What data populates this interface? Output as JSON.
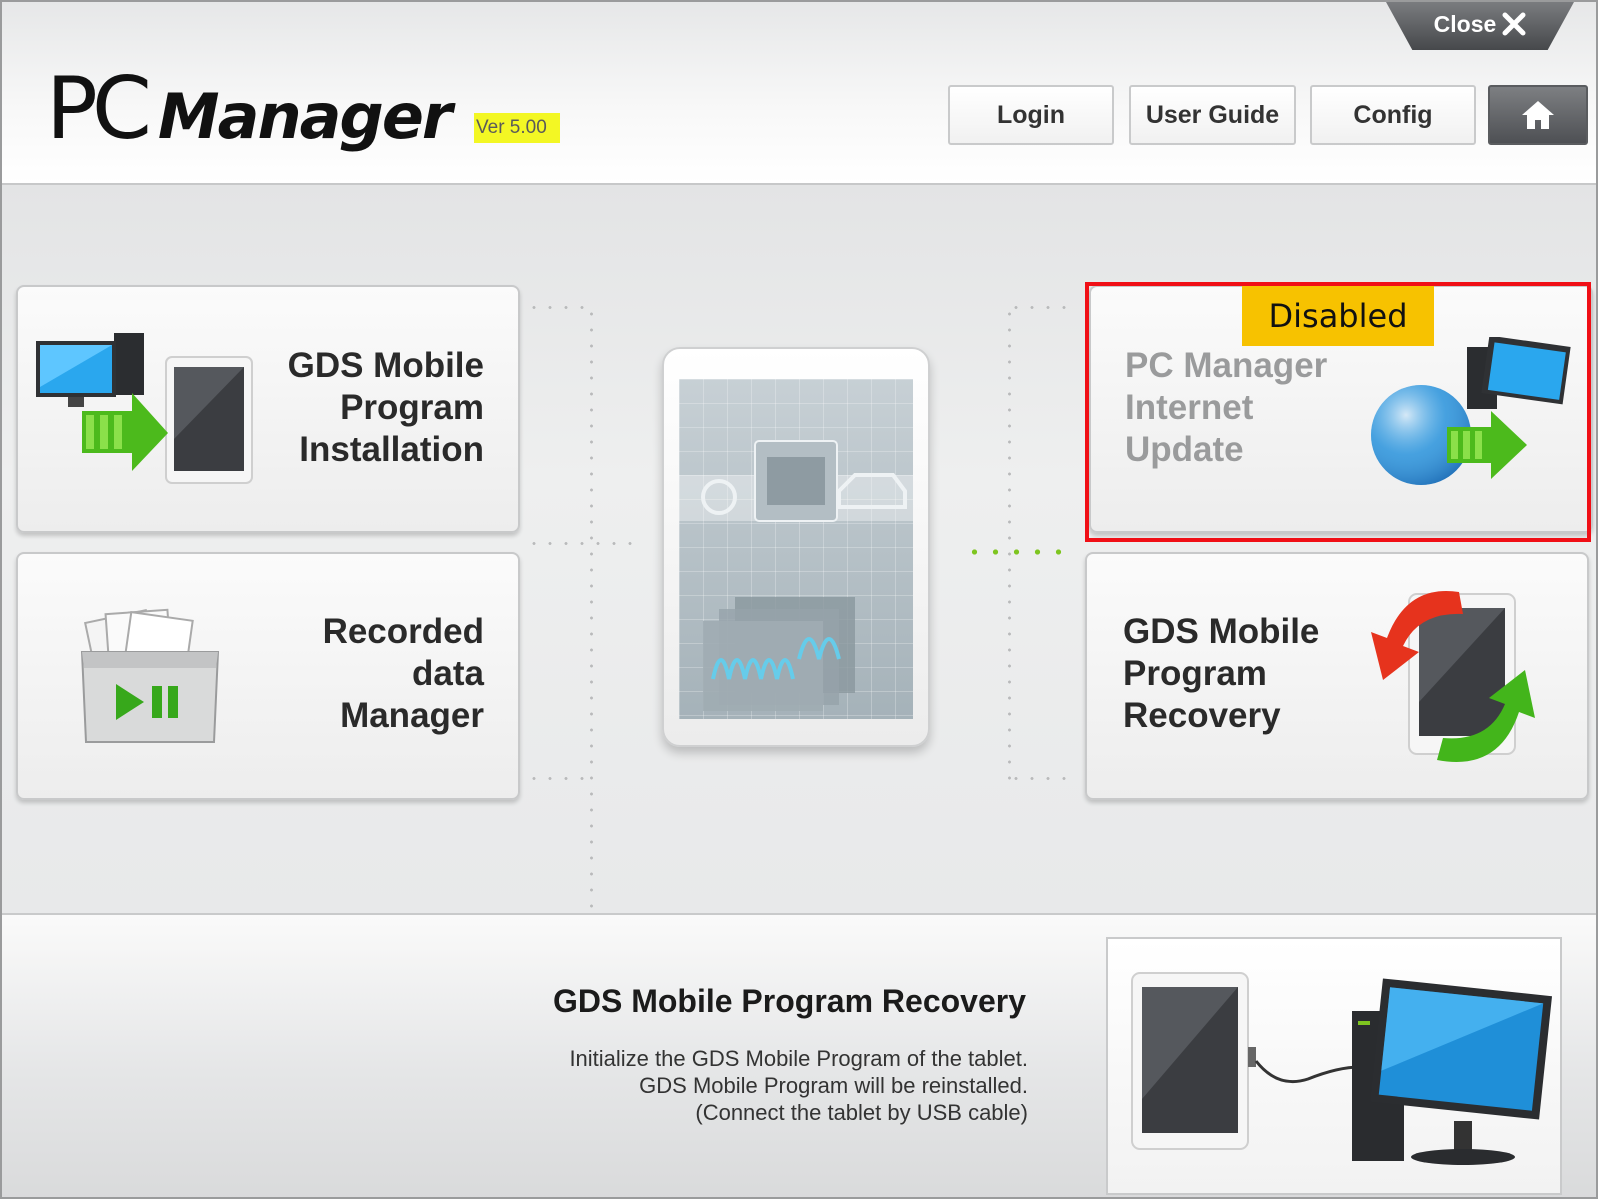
{
  "header": {
    "logo_pc": "PC",
    "logo_manager": "Manager",
    "version": "Ver 5.00",
    "close_label": "Close",
    "close_icon": "close-x-icon",
    "buttons": {
      "login": "Login",
      "user_guide": "User Guide",
      "config": "Config",
      "home_icon": "home-icon"
    }
  },
  "cards": {
    "install": {
      "line1": "GDS Mobile",
      "line2": "Program",
      "line3": "Installation",
      "icon": "pc-to-tablet-icon"
    },
    "recorded": {
      "line1": "Recorded",
      "line2": "data",
      "line3": "Manager",
      "icon": "folder-play-pause-icon"
    },
    "update": {
      "line1": "PC Manager",
      "line2": "Internet",
      "line3": "Update",
      "icon": "globe-to-pc-icon",
      "disabled_label": "Disabled"
    },
    "recovery": {
      "line1": "GDS Mobile",
      "line2": "Program",
      "line3": "Recovery",
      "icon": "tablet-sync-icon"
    }
  },
  "bottom": {
    "title": "GDS Mobile Program Recovery",
    "desc1": "Initialize the GDS Mobile Program of the tablet.",
    "desc2": "GDS Mobile Program will be reinstalled.",
    "desc3": "(Connect the tablet by USB cable)",
    "preview_icon": "tablet-usb-pc-icon"
  },
  "colors": {
    "highlight": "#f00f16",
    "disabled_tag": "#f7c200",
    "version_highlight": "#f3f724",
    "accent_green": "#7ec520"
  }
}
